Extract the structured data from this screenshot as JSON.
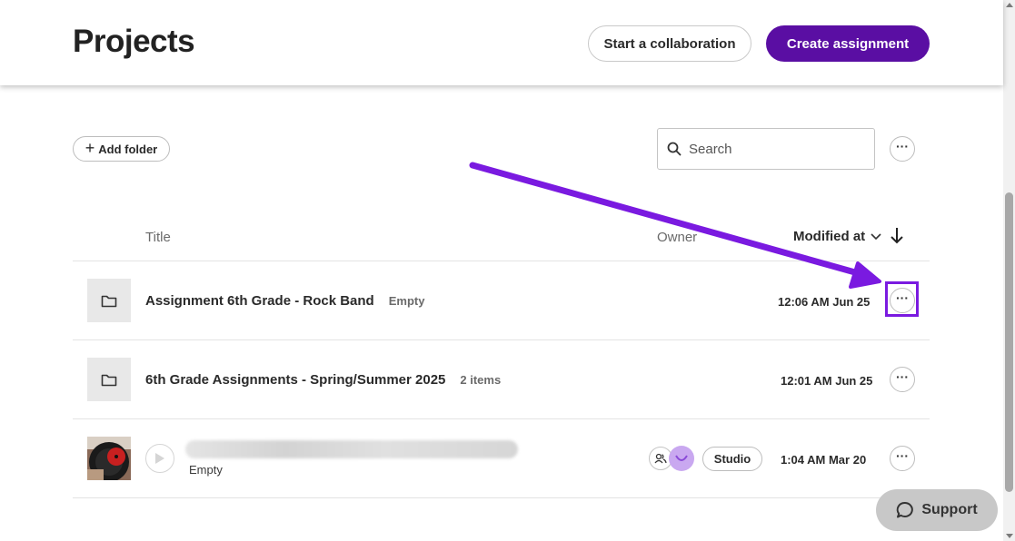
{
  "header": {
    "title": "Projects",
    "collab_label": "Start a collaboration",
    "create_label": "Create assignment"
  },
  "toolbar": {
    "add_folder_label": "Add folder",
    "search_placeholder": "Search"
  },
  "table": {
    "columns": {
      "title": "Title",
      "owner": "Owner",
      "modified": "Modified at"
    },
    "rows": [
      {
        "title": "Assignment 6th Grade - Rock Band",
        "meta": "Empty",
        "modified": "12:06 AM Jun 25",
        "type": "folder-icon"
      },
      {
        "title": "6th Grade Assignments - Spring/Summer 2025",
        "meta": "2 items",
        "modified": "12:01 AM Jun 25",
        "type": "folder-icon"
      },
      {
        "title": "",
        "meta": "Empty",
        "modified": "1:04 AM Mar 20",
        "tag": "Studio",
        "type": "project-thumbnail"
      }
    ]
  },
  "support": {
    "label": "Support"
  },
  "colors": {
    "accent": "#5a0ea3",
    "annotation": "#7a1ae0",
    "support_bg": "#c8c8c8"
  }
}
